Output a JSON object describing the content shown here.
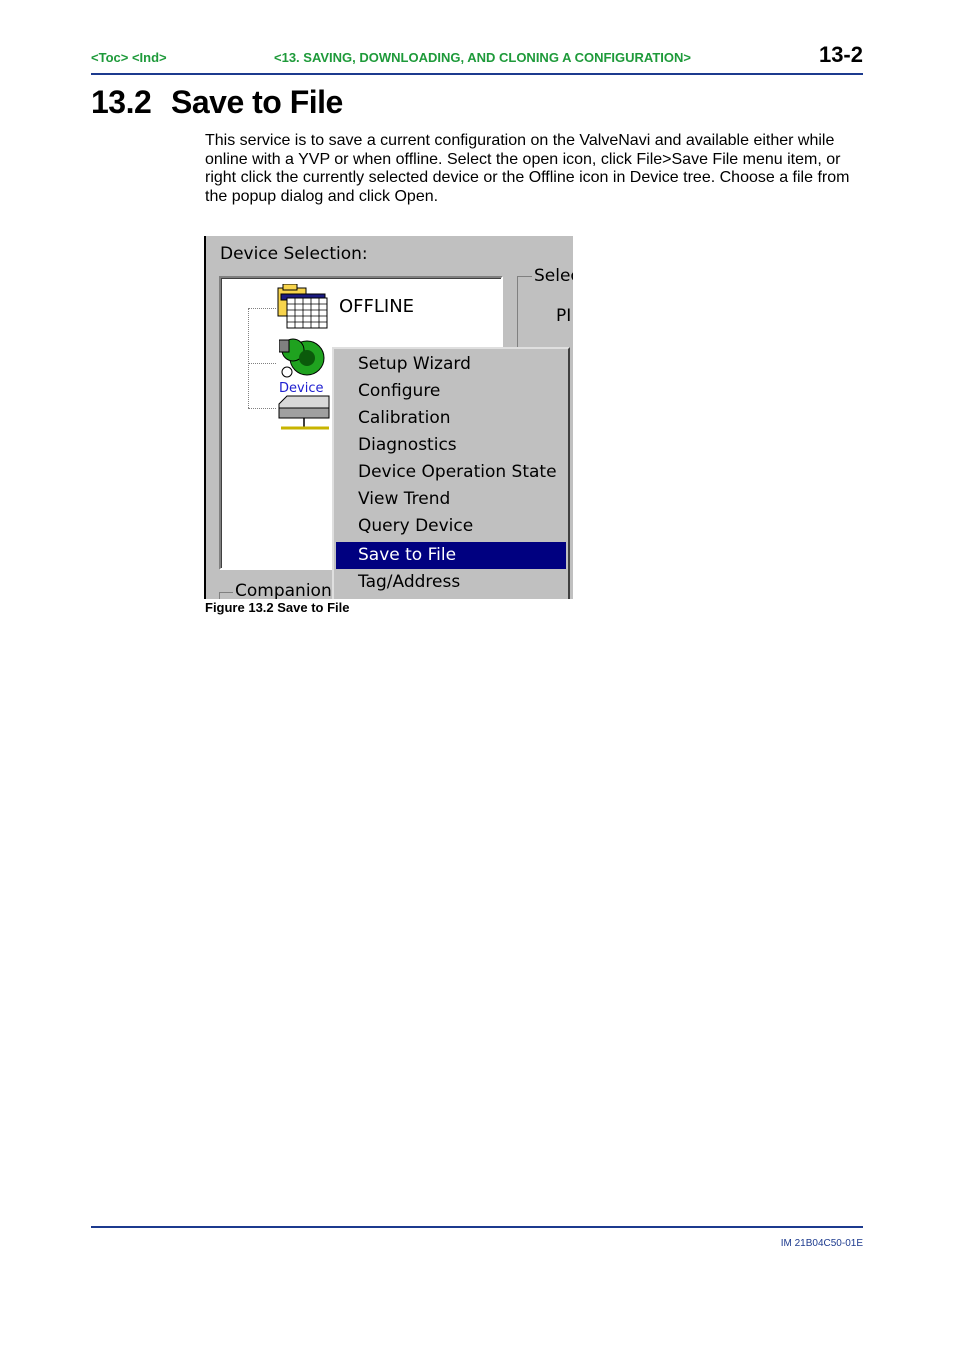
{
  "header": {
    "toc_ind": "<Toc> <Ind>",
    "chapter_title": "<13.  SAVING, DOWNLOADING, AND CLONING A CONFIGURATION>",
    "page_number": "13-2"
  },
  "section": {
    "number": "13.2",
    "title": "Save to File",
    "body": "This service is to save a current configuration on the ValveNavi and available either while online with a YVP or when offline.  Select the open  icon, click File>Save File menu item, or right click the currently selected device or the Offline icon in Device tree.  Choose a file from the popup dialog and click Open."
  },
  "figure": {
    "device_selection_label": "Device Selection:",
    "tree": {
      "offline_label": "OFFLINE",
      "device_label": "Device"
    },
    "select_group_label": "Selec",
    "pd_text": "PI",
    "companion_label": "Companion D",
    "menu_items": [
      {
        "label": "Setup Wizard",
        "selected": false
      },
      {
        "label": "Configure",
        "selected": false
      },
      {
        "label": "Calibration",
        "selected": false
      },
      {
        "label": "Diagnostics",
        "selected": false
      },
      {
        "label": "Device Operation State",
        "selected": false
      },
      {
        "label": "View Trend",
        "selected": false
      },
      {
        "label": "Query Device",
        "selected": false
      },
      {
        "label": "Save to File",
        "selected": true
      },
      {
        "label": "Tag/Address",
        "selected": false
      }
    ],
    "selection_color": "#000080",
    "caption": "Figure 13.2 Save to File"
  },
  "footer": {
    "doc_id": "IM 21B04C50-01E"
  },
  "colors": {
    "link_green": "#1e9a3a",
    "rule_blue": "#1c3a8e"
  }
}
